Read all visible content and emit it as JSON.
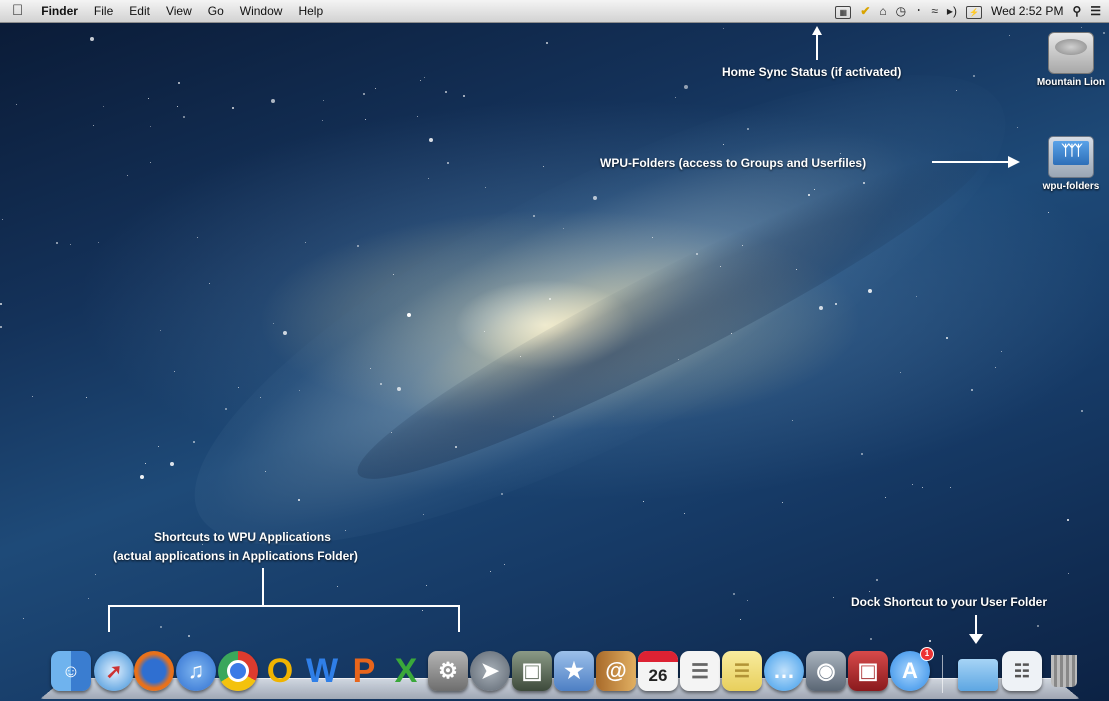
{
  "menubar": {
    "apple_icon": "apple-icon",
    "app_name": "Finder",
    "menus": [
      "File",
      "Edit",
      "View",
      "Go",
      "Window",
      "Help"
    ],
    "status_icons": [
      "calendar-menu-icon",
      "checkmark-icon",
      "home-sync-icon",
      "time-machine-icon",
      "bluetooth-icon",
      "wifi-icon",
      "volume-icon",
      "battery-icon"
    ],
    "clock": "Wed 2:52 PM",
    "right_icons": [
      "spotlight-search-icon",
      "notification-center-icon"
    ]
  },
  "desktop": {
    "icons": [
      {
        "label": "Mountain Lion",
        "icon": "hard-drive-icon"
      },
      {
        "label": "wpu-folders",
        "icon": "server-share-icon"
      }
    ]
  },
  "annotations": {
    "home_sync": "Home Sync Status (if activated)",
    "wpu_folders": "WPU-Folders (access to Groups and Userfiles)",
    "shortcuts_line1": "Shortcuts to WPU Applications",
    "shortcuts_line2": "(actual applications in Applications Folder)",
    "dock_shortcut": "Dock Shortcut to your User Folder"
  },
  "dock": {
    "apps": [
      {
        "name": "Finder",
        "icon": "finder-icon",
        "color": "#4a90d9"
      },
      {
        "name": "Safari",
        "icon": "safari-icon",
        "color": "#3b8fd8"
      },
      {
        "name": "Firefox",
        "icon": "firefox-icon",
        "color": "#e8711b"
      },
      {
        "name": "iTunes",
        "icon": "itunes-icon",
        "color": "#2f6fd1"
      },
      {
        "name": "Chrome",
        "icon": "chrome-icon",
        "color": "#dd3b2e"
      },
      {
        "name": "Outlook",
        "icon": "outlook-icon",
        "color": "#f0b400"
      },
      {
        "name": "Word",
        "icon": "word-icon",
        "color": "#2f7fe8"
      },
      {
        "name": "PowerPoint",
        "icon": "powerpoint-icon",
        "color": "#e8651b"
      },
      {
        "name": "Excel",
        "icon": "excel-icon",
        "color": "#3aa83a"
      },
      {
        "name": "System Preferences",
        "icon": "system-preferences-icon",
        "color": "#8e8e8e"
      },
      {
        "name": "Launchpad",
        "icon": "launchpad-icon",
        "color": "#7f8790"
      },
      {
        "name": "Image Capture",
        "icon": "image-capture-icon",
        "color": "#5d6a5a"
      },
      {
        "name": "Preview",
        "icon": "preview-icon",
        "color": "#4d7fc4"
      },
      {
        "name": "Contacts",
        "icon": "contacts-icon",
        "color": "#c98e3a"
      },
      {
        "name": "Calendar",
        "icon": "calendar-icon",
        "color": "#f4f4f4",
        "day": "26"
      },
      {
        "name": "Reminders",
        "icon": "reminders-icon",
        "color": "#f4f4f4"
      },
      {
        "name": "Notes",
        "icon": "notes-icon",
        "color": "#f3e08a"
      },
      {
        "name": "Messages",
        "icon": "messages-icon",
        "color": "#3c9bea"
      },
      {
        "name": "FaceTime",
        "icon": "facetime-icon",
        "color": "#6c7a89"
      },
      {
        "name": "Photo Booth",
        "icon": "photo-booth-icon",
        "color": "#b8282b"
      },
      {
        "name": "App Store",
        "icon": "app-store-icon",
        "color": "#2f8be6",
        "badge": "1"
      }
    ],
    "folders": [
      {
        "name": "User Folder",
        "icon": "user-folder-icon",
        "color": "#6fb5ea"
      },
      {
        "name": "Documents",
        "icon": "document-stack-icon",
        "color": "#eef2f6"
      },
      {
        "name": "Trash",
        "icon": "trash-icon",
        "color": "#aaaaaa"
      }
    ]
  }
}
